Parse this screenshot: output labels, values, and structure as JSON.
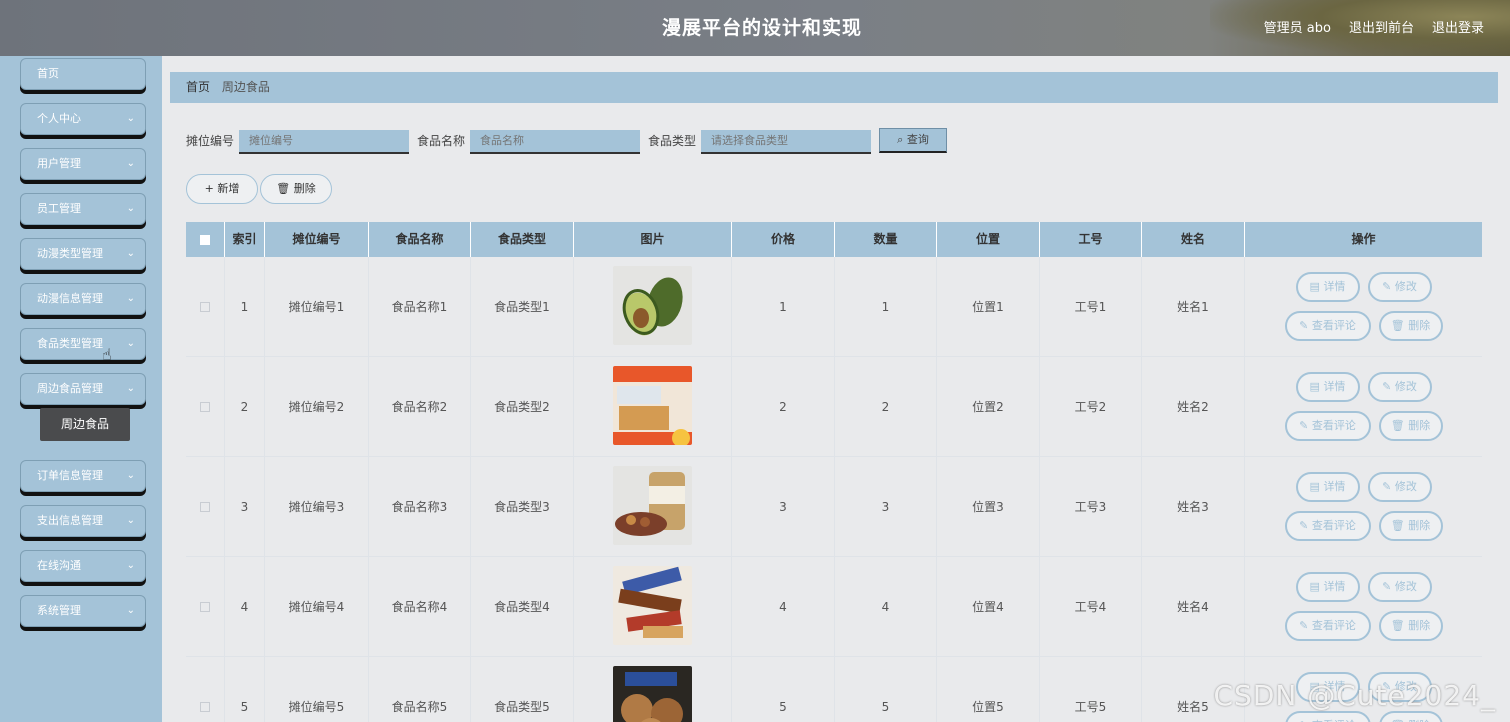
{
  "header": {
    "title": "漫展平台的设计和实现",
    "admin": "管理员 abo",
    "to_front": "退出到前台",
    "logout": "退出登录"
  },
  "sidebar": {
    "items": [
      {
        "label": "首页",
        "chevron": false
      },
      {
        "label": "个人中心",
        "chevron": true
      },
      {
        "label": "用户管理",
        "chevron": true
      },
      {
        "label": "员工管理",
        "chevron": true
      },
      {
        "label": "动漫类型管理",
        "chevron": true
      },
      {
        "label": "动漫信息管理",
        "chevron": true
      },
      {
        "label": "食品类型管理",
        "chevron": true
      },
      {
        "label": "周边食品管理",
        "chevron": true
      },
      {
        "label": "订单信息管理",
        "chevron": true
      },
      {
        "label": "支出信息管理",
        "chevron": true
      },
      {
        "label": "在线沟通",
        "chevron": true
      },
      {
        "label": "系统管理",
        "chevron": true
      }
    ],
    "submenu_label": "周边食品"
  },
  "breadcrumb": {
    "home": "首页",
    "current": "周边食品"
  },
  "search": {
    "stall_label": "摊位编号",
    "stall_placeholder": "摊位编号",
    "name_label": "食品名称",
    "name_placeholder": "食品名称",
    "type_label": "食品类型",
    "type_placeholder": "请选择食品类型",
    "query_label": "查询"
  },
  "actions": {
    "add_label": "新增",
    "delete_label": "删除"
  },
  "table": {
    "headers": [
      "索引",
      "摊位编号",
      "食品名称",
      "食品类型",
      "图片",
      "价格",
      "数量",
      "位置",
      "工号",
      "姓名",
      "操作"
    ],
    "rows": [
      {
        "index": "1",
        "stall": "摊位编号1",
        "name": "食品名称1",
        "type": "食品类型1",
        "image": "avocado",
        "price": "1",
        "qty": "1",
        "location": "位置1",
        "staff_no": "工号1",
        "staff_name": "姓名1"
      },
      {
        "index": "2",
        "stall": "摊位编号2",
        "name": "食品名称2",
        "type": "食品类型2",
        "image": "snack-box",
        "price": "2",
        "qty": "2",
        "location": "位置2",
        "staff_no": "工号2",
        "staff_name": "姓名2"
      },
      {
        "index": "3",
        "stall": "摊位编号3",
        "name": "食品名称3",
        "type": "食品类型3",
        "image": "nuts-jar",
        "price": "3",
        "qty": "3",
        "location": "位置3",
        "staff_no": "工号3",
        "staff_name": "姓名3"
      },
      {
        "index": "4",
        "stall": "摊位编号4",
        "name": "食品名称4",
        "type": "食品类型4",
        "image": "chocolate-bars",
        "price": "4",
        "qty": "4",
        "location": "位置4",
        "staff_no": "工号4",
        "staff_name": "姓名4"
      },
      {
        "index": "5",
        "stall": "摊位编号5",
        "name": "食品名称5",
        "type": "食品类型5",
        "image": "cookies",
        "price": "5",
        "qty": "5",
        "location": "位置5",
        "staff_no": "工号5",
        "staff_name": "姓名5"
      }
    ],
    "op_labels": {
      "detail": "详情",
      "edit": "修改",
      "comments": "查看评论",
      "delete": "删除"
    }
  },
  "watermark": "CSDN @Cute2024_",
  "colors": {
    "accent": "#a4c3d8",
    "background": "#e9eaec",
    "submenu_bg": "#4a4b4d"
  }
}
